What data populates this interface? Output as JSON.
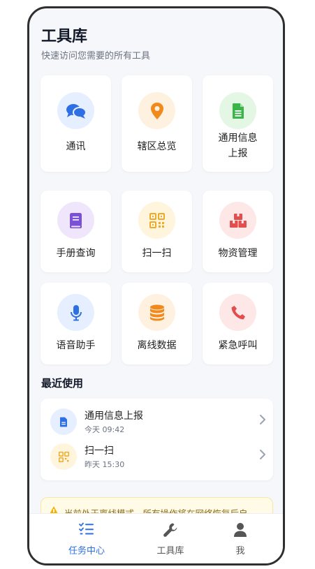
{
  "header": {
    "title": "工具库",
    "subtitle": "快速访问您需要的所有工具"
  },
  "tools": [
    {
      "label": "通讯",
      "icon": "chat-bubbles-icon",
      "bg": "#e6efff",
      "color": "#2f6fe4"
    },
    {
      "label": "辖区总览",
      "icon": "map-pin-icon",
      "bg": "#fff1e0",
      "color": "#f08a1c"
    },
    {
      "label": "通用信息上报",
      "label_line1": "通用信息",
      "label_line2": "上报",
      "icon": "document-icon",
      "bg": "#e4f6e4",
      "color": "#3bb54a"
    },
    {
      "label": "手册查询",
      "icon": "book-icon",
      "bg": "#efe6fb",
      "color": "#7b4fd6"
    },
    {
      "label": "扫一扫",
      "icon": "qr-code-icon",
      "bg": "#fff4dc",
      "color": "#f0a928"
    },
    {
      "label": "物资管理",
      "icon": "boxes-icon",
      "bg": "#fde7e7",
      "color": "#e24d4d"
    },
    {
      "label": "语音助手",
      "icon": "microphone-icon",
      "bg": "#e6efff",
      "color": "#2f6fe4"
    },
    {
      "label": "离线数据",
      "icon": "database-icon",
      "bg": "#fff1e0",
      "color": "#f08a1c"
    },
    {
      "label": "紧急呼叫",
      "icon": "phone-icon",
      "bg": "#fde7e7",
      "color": "#e24d4d"
    }
  ],
  "recent": {
    "title": "最近使用",
    "items": [
      {
        "name": "通用信息上报",
        "time": "今天 09:42",
        "icon": "document-icon",
        "bg": "#e6efff",
        "color": "#2f6fe4"
      },
      {
        "name": "扫一扫",
        "time": "昨天 15:30",
        "icon": "qr-code-icon",
        "bg": "#fff4dc",
        "color": "#f0a928"
      }
    ]
  },
  "notice": {
    "text": "当前处于离线模式，所有操作将在网络恢复后自"
  },
  "tabbar": {
    "tabs": [
      {
        "label": "任务中心",
        "icon": "task-list-icon",
        "active": true
      },
      {
        "label": "工具库",
        "icon": "wrench-icon",
        "active": false
      },
      {
        "label": "我",
        "icon": "user-icon",
        "active": false
      }
    ]
  },
  "colors": {
    "accent": "#2f6fe4",
    "background": "#f6f7fb",
    "warning_bg": "#fffbe6",
    "warning_text": "#8a6d1a"
  }
}
